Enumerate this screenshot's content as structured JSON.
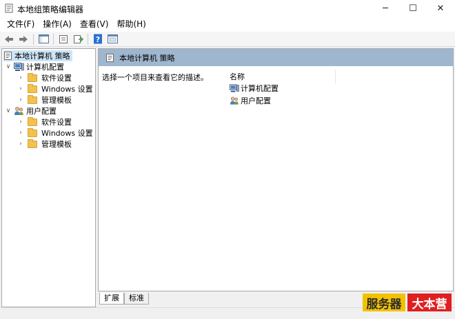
{
  "window": {
    "title": "本地组策略编辑器",
    "minimize_glyph": "─",
    "maximize_glyph": "☐",
    "close_glyph": "✕"
  },
  "menu": [
    {
      "label": "文件(F)"
    },
    {
      "label": "操作(A)"
    },
    {
      "label": "查看(V)"
    },
    {
      "label": "帮助(H)"
    }
  ],
  "toolbar": {
    "icons": [
      "back-arrow-icon",
      "forward-arrow-icon",
      "show-hide-tree-icon",
      "properties-icon",
      "export-list-icon",
      "help-icon",
      "view-icon"
    ]
  },
  "tree": {
    "root": "本地计算机 策略",
    "computer_config": "计算机配置",
    "computer_children": [
      "软件设置",
      "Windows 设置",
      "管理模板"
    ],
    "user_config": "用户配置",
    "user_children": [
      "软件设置",
      "Windows 设置",
      "管理模板"
    ]
  },
  "main": {
    "header_title": "本地计算机 策略",
    "description": "选择一个项目来查看它的描述。",
    "column_name": "名称",
    "items": [
      {
        "label": "计算机配置",
        "icon": "computer-icon"
      },
      {
        "label": "用户配置",
        "icon": "users-icon"
      }
    ]
  },
  "tabs": [
    {
      "label": "扩展",
      "active": true
    },
    {
      "label": "标准",
      "active": false
    }
  ],
  "watermark": {
    "left": "服务器",
    "right": "大本营"
  },
  "colors": {
    "header_bg": "#9fb6cf",
    "selection_bg": "#cce4f7",
    "folder": "#f2c14e",
    "watermark_yellow": "#f2c200",
    "watermark_red": "#e02020"
  }
}
